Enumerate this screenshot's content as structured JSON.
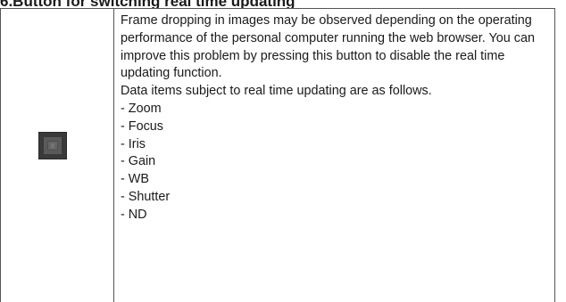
{
  "heading": "6.Button for switching real time updating",
  "description": "Frame dropping in images may be observed depending on the operating performance of the personal computer running the web browser. You can improve this problem by pressing this button to disable the real time updating function.",
  "items_intro": "Data items subject to real time updating are as follows.",
  "items": [
    "- Zoom",
    "- Focus",
    "- Iris",
    "- Gain",
    "- WB",
    "- Shutter",
    "- ND"
  ],
  "icon": "real-time-update-toggle-icon"
}
